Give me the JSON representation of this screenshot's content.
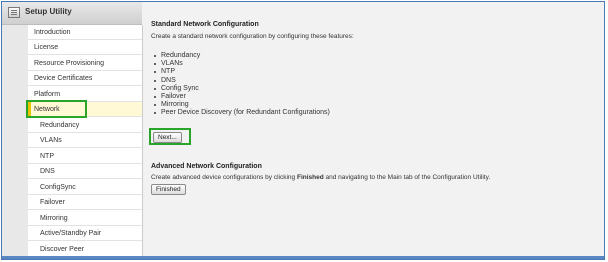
{
  "app": {
    "title": "Setup Utility",
    "icon": "utility-window-icon"
  },
  "sidebar": {
    "items": [
      {
        "label": "Introduction",
        "level": 0,
        "selected": false
      },
      {
        "label": "License",
        "level": 0,
        "selected": false
      },
      {
        "label": "Resource Provisioning",
        "level": 0,
        "selected": false
      },
      {
        "label": "Device Certificates",
        "level": 0,
        "selected": false
      },
      {
        "label": "Platform",
        "level": 0,
        "selected": false
      },
      {
        "label": "Network",
        "level": 0,
        "selected": true
      },
      {
        "label": "Redundancy",
        "level": 1,
        "selected": false
      },
      {
        "label": "VLANs",
        "level": 1,
        "selected": false
      },
      {
        "label": "NTP",
        "level": 1,
        "selected": false
      },
      {
        "label": "DNS",
        "level": 1,
        "selected": false
      },
      {
        "label": "ConfigSync",
        "level": 1,
        "selected": false
      },
      {
        "label": "Failover",
        "level": 1,
        "selected": false
      },
      {
        "label": "Mirroring",
        "level": 1,
        "selected": false
      },
      {
        "label": "Active/Standby Pair",
        "level": 1,
        "selected": false
      },
      {
        "label": "Discover Peer",
        "level": 1,
        "selected": false
      }
    ]
  },
  "main": {
    "standard": {
      "heading": "Standard Network Configuration",
      "description": "Create a standard network configuration by configuring these features:",
      "features": [
        "Redundancy",
        "VLANs",
        "NTP",
        "DNS",
        "Config Sync",
        "Failover",
        "Mirroring",
        "Peer Device Discovery (for Redundant Configurations)"
      ],
      "next_label": "Next..."
    },
    "advanced": {
      "heading": "Advanced Network Configuration",
      "description_before": "Create advanced device configurations by clicking ",
      "description_bold": "Finished",
      "description_after": " and navigating to the Main tab of the Configuration Utility.",
      "finished_label": "Finished"
    }
  },
  "colors": {
    "highlight_green": "#2aa52a",
    "selected_marker": "#e8c400",
    "frame_blue": "#4a78b4"
  }
}
